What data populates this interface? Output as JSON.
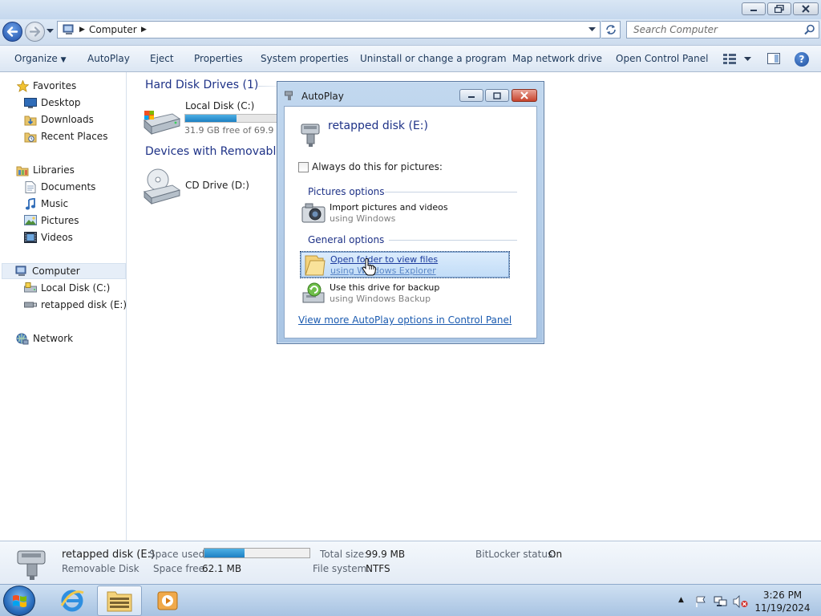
{
  "window": {
    "address_path": "Computer",
    "search_placeholder": "Search Computer"
  },
  "command_bar": {
    "organize": "Organize",
    "autoplay": "AutoPlay",
    "eject": "Eject",
    "properties": "Properties",
    "system_properties": "System properties",
    "uninstall": "Uninstall or change a program",
    "map_network_drive": "Map network drive",
    "open_control_panel": "Open Control Panel"
  },
  "nav_pane": {
    "favorites": "Favorites",
    "desktop": "Desktop",
    "downloads": "Downloads",
    "recent_places": "Recent Places",
    "libraries": "Libraries",
    "documents": "Documents",
    "music": "Music",
    "pictures": "Pictures",
    "videos": "Videos",
    "computer": "Computer",
    "local_disk": "Local Disk (C:)",
    "retapped_disk": "retapped disk (E:)",
    "network": "Network"
  },
  "content": {
    "hard_disk_header": "Hard Disk Drives (1)",
    "local_disk_name": "Local Disk (C:)",
    "local_disk_free": "31.9 GB free of 69.9 GB",
    "local_disk_used_fraction": 0.54,
    "removable_header": "Devices with Removable Storage (2)",
    "cd_drive_name": "CD Drive (D:)"
  },
  "autoplay_dialog": {
    "title": "AutoPlay",
    "device_name": "retapped disk (E:)",
    "always_do_label": "Always do this for pictures:",
    "always_do_checked": false,
    "pictures_options_header": "Pictures options",
    "import_title": "Import pictures and videos",
    "import_sub": "using Windows",
    "general_options_header": "General options",
    "open_folder_title": "Open folder to view files",
    "open_folder_sub": "using Windows Explorer",
    "backup_title": "Use this drive for backup",
    "backup_sub": "using Windows Backup",
    "more_options_link": "View more AutoPlay options in Control Panel"
  },
  "details_pane": {
    "name": "retapped disk (E:)",
    "type": "Removable Disk",
    "space_used_label": "Space used:",
    "space_used_fraction": 0.38,
    "space_free_label": "Space free:",
    "space_free_value": "62.1 MB",
    "total_size_label": "Total size:",
    "total_size_value": "99.9 MB",
    "file_system_label": "File system:",
    "file_system_value": "NTFS",
    "bitlocker_label": "BitLocker status:",
    "bitlocker_value": "On"
  },
  "taskbar": {
    "time": "3:26 PM",
    "date": "11/19/2024"
  },
  "colors": {
    "accent_blue": "#1e3287",
    "link_blue": "#1b5bb0",
    "capacity_fill": "#1c80c3"
  }
}
